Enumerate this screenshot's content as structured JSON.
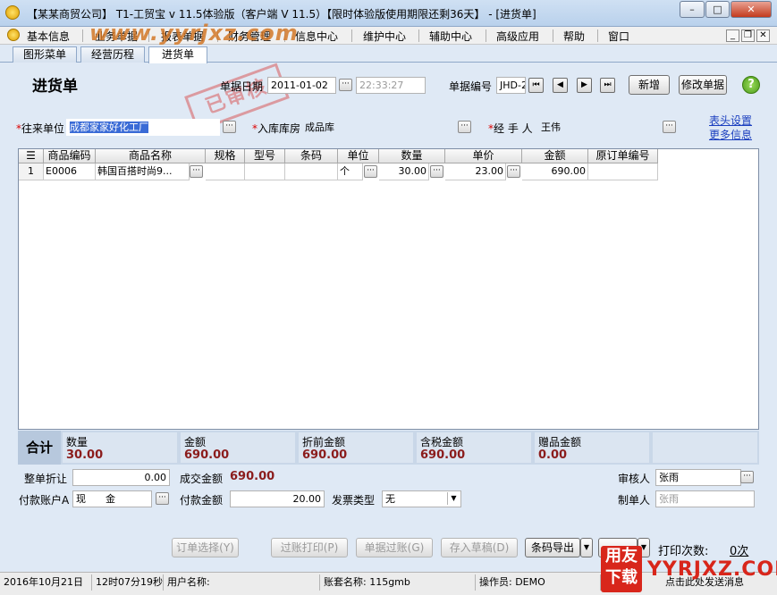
{
  "window": {
    "title": "【某某商贸公司】 T1-工贸宝 v 11.5体验版（客户端 V 11.5）【限时体验版使用期限还剩36天】 - [进货单]",
    "minimize_glyph": "–",
    "maximize_glyph": "□",
    "close_glyph": "✕"
  },
  "watermark": "www.yyrjxz.com",
  "menu": {
    "items": [
      "基本信息",
      "业务单据",
      "报表单据",
      "财务管理",
      "信息中心",
      "维护中心",
      "辅助中心",
      "高级应用",
      "帮助",
      "窗口"
    ],
    "mdi_buttons": [
      "_",
      "❐",
      "✕"
    ]
  },
  "tabs": [
    "图形菜单",
    "经营历程",
    "进货单"
  ],
  "doc": {
    "title": "进货单",
    "stamp": "已审核",
    "date_label": "单据日期",
    "date_value": "2011-01-02",
    "time_value": "22:33:27",
    "number_label": "单据编号",
    "number_value": "JHD-2",
    "add_button": "新增",
    "edit_button": "修改单据",
    "help_glyph": "?"
  },
  "fields": {
    "partner_label": "往来单位",
    "partner_value": "成都家家好化工厂",
    "warehouse_label": "入库库房",
    "warehouse_value": "成品库",
    "handler_label": "经 手 人",
    "handler_value": "王伟",
    "header_settings_link": "表头设置",
    "more_info_link": "更多信息"
  },
  "table": {
    "columns": [
      "商品编码",
      "商品名称",
      "规格",
      "型号",
      "条码",
      "单位",
      "数量",
      "单价",
      "金额",
      "原订单编号"
    ],
    "rows": [
      {
        "index": "1",
        "code": "E0006",
        "name": "韩国百搭时尚9...",
        "spec": "",
        "model": "",
        "barcode": "",
        "unit": "个",
        "qty": "30.00",
        "price": "23.00",
        "amount": "690.00",
        "order_no": ""
      }
    ]
  },
  "totals": {
    "heading": "合计",
    "qty_label": "数量",
    "qty_value": "30.00",
    "amount_label": "金额",
    "amount_value": "690.00",
    "pre_discount_label": "折前金额",
    "pre_discount_value": "690.00",
    "tax_incl_label": "含税金额",
    "tax_incl_value": "690.00",
    "gift_label": "赠品金额",
    "gift_value": "0.00"
  },
  "footer_form": {
    "discount_label": "整单折让",
    "discount_value": "0.00",
    "deal_amount_label": "成交金额",
    "deal_amount_value": "690.00",
    "reviewer_label": "审核人",
    "reviewer_value": "张雨",
    "payment_account_label": "付款账户A",
    "payment_account_value": "现　　金",
    "payment_amount_label": "付款金额",
    "payment_amount_value": "20.00",
    "invoice_type_label": "发票类型",
    "invoice_type_value": "无",
    "maker_label": "制单人",
    "maker_value": "张雨"
  },
  "actions": {
    "order_select": "订单选择(Y)",
    "post_print": "过账打印(P)",
    "post": "单据过账(G)",
    "save_draft": "存入草稿(D)",
    "barcode_export": "条码导出",
    "print_count_label": "打印次数:",
    "print_count_value": "0次"
  },
  "status": {
    "date": "2016年10月21日",
    "time": "12时07分19秒",
    "user_label": "用户名称:",
    "account_label": "账套名称: 115gmb",
    "operator_label": "操作员: DEMO",
    "extra": "点击此处发送消息"
  },
  "logo": {
    "badge": "用友下载",
    "text": "YYRJXZ.COM"
  },
  "colors": {
    "titlebar": "#c4d8ee",
    "totals_value": "#8b1c1c",
    "required_mark": "#dd0000",
    "link": "#1b3fbf",
    "logo_red": "#d8261b"
  }
}
